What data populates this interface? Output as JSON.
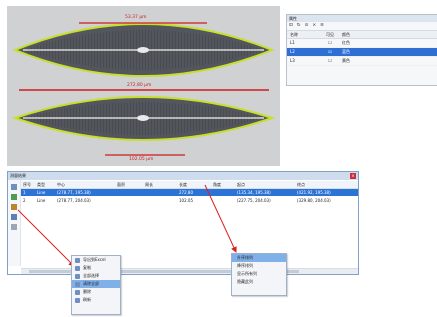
{
  "image": {
    "top_length_label": "53.37 μm",
    "middle_width_label": "272.80 μm",
    "bottom_length_label": "102.05 μm"
  },
  "properties_panel": {
    "title": "属性",
    "toolbar": [
      "⊡",
      "↻",
      "⊙",
      "×",
      "≡"
    ],
    "headers": [
      "名称",
      "可见",
      "颜色"
    ],
    "rows": [
      {
        "name": "L1",
        "visible": "☐",
        "color": "红色"
      },
      {
        "name": "L2",
        "visible": "☑",
        "color": "蓝色"
      },
      {
        "name": "L3",
        "visible": "☐",
        "color": "黄色"
      }
    ]
  },
  "measurement_table": {
    "title": "测量结果",
    "close_label": "×",
    "headers": [
      "序号",
      "类型",
      "中心",
      "面积",
      "周长",
      "长度",
      "角度",
      "起点",
      "终点"
    ],
    "rows": [
      [
        "1",
        "Line",
        "(278.77, 195.38)",
        "",
        "",
        "272.80",
        "",
        "(135.34, 195.38)",
        "(421.92, 195.38)"
      ],
      [
        "2",
        "Line",
        "(278.77, 204.03)",
        "",
        "",
        "102.05",
        "",
        "(227.75, 204.03)",
        "(329.80, 204.03)"
      ]
    ]
  },
  "context_menu_left": {
    "items": [
      {
        "label": "导出到Excel",
        "selected": false
      },
      {
        "label": "复制",
        "selected": false
      },
      {
        "label": "全部选择",
        "selected": false
      },
      {
        "label": "清除全部",
        "selected": true
      },
      {
        "label": "删除",
        "selected": false
      },
      {
        "label": "刷新",
        "selected": false
      }
    ]
  },
  "context_menu_right": {
    "items": [
      {
        "label": "升序排列",
        "selected": true
      },
      {
        "label": "降序排列",
        "selected": false
      },
      {
        "label": "显示所有列",
        "selected": false
      },
      {
        "label": "隐藏此列",
        "selected": false
      }
    ]
  },
  "colors": {
    "outline": "#c8df2a",
    "measure_red": "#d01c1c",
    "selection_blue": "#2c73d6",
    "arrow": "#d82222"
  }
}
